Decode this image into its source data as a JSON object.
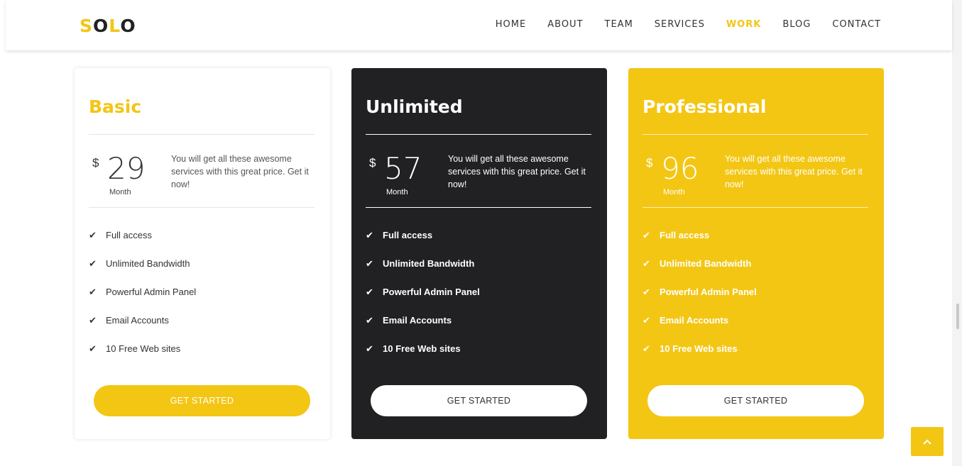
{
  "brand": {
    "logo_first": "S",
    "logo_mid": "O",
    "logo_accent": "L",
    "logo_last": "O",
    "accent_color": "#f3c614"
  },
  "nav": {
    "items": [
      "HOME",
      "ABOUT",
      "TEAM",
      "SERVICES",
      "WORK",
      "BLOG",
      "CONTACT"
    ],
    "active": "WORK"
  },
  "plans": [
    {
      "name": "Basic",
      "currency": "$",
      "price": "29",
      "period": "Month",
      "description": "You will get all these awesome services with this great price. Get it now!",
      "features": [
        "Full access",
        "Unlimited Bandwidth",
        "Powerful Admin Panel",
        "Email Accounts",
        "10 Free Web sites"
      ],
      "button": "GET STARTED",
      "background": "#ffffff"
    },
    {
      "name": "Unlimited",
      "currency": "$",
      "price": "57",
      "period": "Month",
      "description": "You will get all these awesome services with this great price. Get it now!",
      "features": [
        "Full access",
        "Unlimited Bandwidth",
        "Powerful Admin Panel",
        "Email Accounts",
        "10 Free Web sites"
      ],
      "button": "GET STARTED",
      "background": "#212124"
    },
    {
      "name": "Professional",
      "currency": "$",
      "price": "96",
      "period": "Month",
      "description": "You will get all these awesome services with this great price. Get it now!",
      "features": [
        "Full access",
        "Unlimited Bandwidth",
        "Powerful Admin Panel",
        "Email Accounts",
        "10 Free Web sites"
      ],
      "button": "GET STARTED",
      "background": "#f3c614"
    }
  ],
  "icons": {
    "check": "check-icon",
    "back_to_top": "chevron-up-icon"
  }
}
